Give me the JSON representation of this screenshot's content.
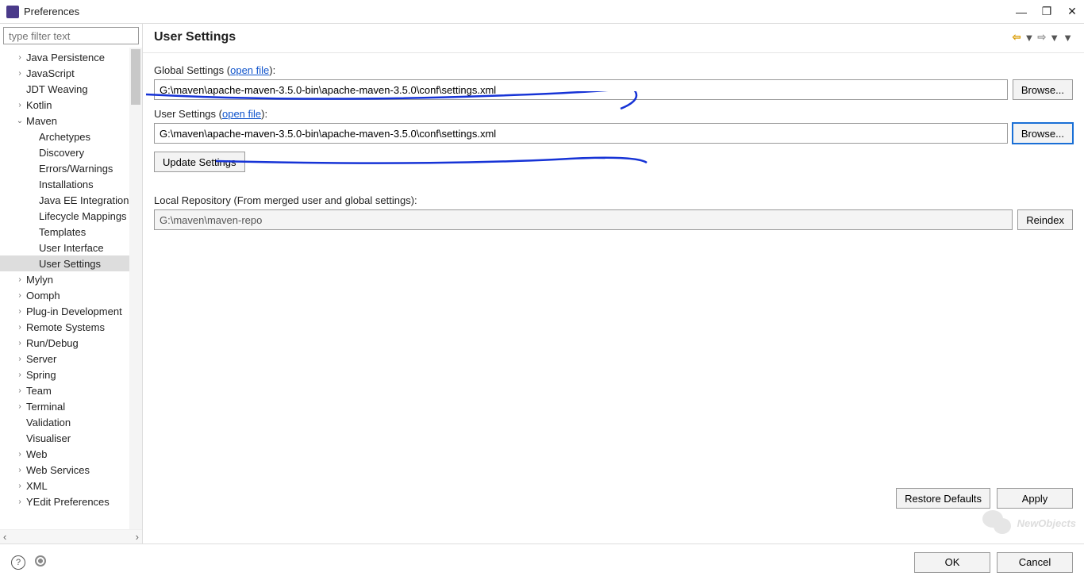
{
  "window": {
    "title": "Preferences"
  },
  "filter": {
    "placeholder": "type filter text"
  },
  "tree": [
    {
      "label": "Java Persistence",
      "indent": 1,
      "arrow": ">"
    },
    {
      "label": "JavaScript",
      "indent": 1,
      "arrow": ">"
    },
    {
      "label": "JDT Weaving",
      "indent": 1,
      "arrow": ""
    },
    {
      "label": "Kotlin",
      "indent": 1,
      "arrow": ">"
    },
    {
      "label": "Maven",
      "indent": 1,
      "arrow": "v",
      "expanded": true
    },
    {
      "label": "Archetypes",
      "indent": 2,
      "arrow": ""
    },
    {
      "label": "Discovery",
      "indent": 2,
      "arrow": ""
    },
    {
      "label": "Errors/Warnings",
      "indent": 2,
      "arrow": ""
    },
    {
      "label": "Installations",
      "indent": 2,
      "arrow": ""
    },
    {
      "label": "Java EE Integration",
      "indent": 2,
      "arrow": ""
    },
    {
      "label": "Lifecycle Mappings",
      "indent": 2,
      "arrow": ""
    },
    {
      "label": "Templates",
      "indent": 2,
      "arrow": ""
    },
    {
      "label": "User Interface",
      "indent": 2,
      "arrow": ""
    },
    {
      "label": "User Settings",
      "indent": 2,
      "arrow": "",
      "selected": true
    },
    {
      "label": "Mylyn",
      "indent": 1,
      "arrow": ">"
    },
    {
      "label": "Oomph",
      "indent": 1,
      "arrow": ">"
    },
    {
      "label": "Plug-in Development",
      "indent": 1,
      "arrow": ">"
    },
    {
      "label": "Remote Systems",
      "indent": 1,
      "arrow": ">"
    },
    {
      "label": "Run/Debug",
      "indent": 1,
      "arrow": ">"
    },
    {
      "label": "Server",
      "indent": 1,
      "arrow": ">"
    },
    {
      "label": "Spring",
      "indent": 1,
      "arrow": ">"
    },
    {
      "label": "Team",
      "indent": 1,
      "arrow": ">"
    },
    {
      "label": "Terminal",
      "indent": 1,
      "arrow": ">"
    },
    {
      "label": "Validation",
      "indent": 1,
      "arrow": ""
    },
    {
      "label": "Visualiser",
      "indent": 1,
      "arrow": ""
    },
    {
      "label": "Web",
      "indent": 1,
      "arrow": ">"
    },
    {
      "label": "Web Services",
      "indent": 1,
      "arrow": ">"
    },
    {
      "label": "XML",
      "indent": 1,
      "arrow": ">"
    },
    {
      "label": "YEdit Preferences",
      "indent": 1,
      "arrow": ">"
    }
  ],
  "page": {
    "title": "User Settings",
    "global_label_prefix": "Global Settings (",
    "global_link": "open file",
    "global_label_suffix": "):",
    "global_value": "G:\\maven\\apache-maven-3.5.0-bin\\apache-maven-3.5.0\\conf\\settings.xml",
    "user_label_prefix": "User Settings (",
    "user_link": "open file",
    "user_label_suffix": "):",
    "user_value": "G:\\maven\\apache-maven-3.5.0-bin\\apache-maven-3.5.0\\conf\\settings.xml",
    "browse": "Browse...",
    "update": "Update Settings",
    "local_repo_label": "Local Repository (From merged user and global settings):",
    "local_repo_value": "G:\\maven\\maven-repo",
    "reindex": "Reindex",
    "restore": "Restore Defaults",
    "apply": "Apply"
  },
  "dialog": {
    "ok": "OK",
    "cancel": "Cancel"
  },
  "watermark": "NewObjects"
}
